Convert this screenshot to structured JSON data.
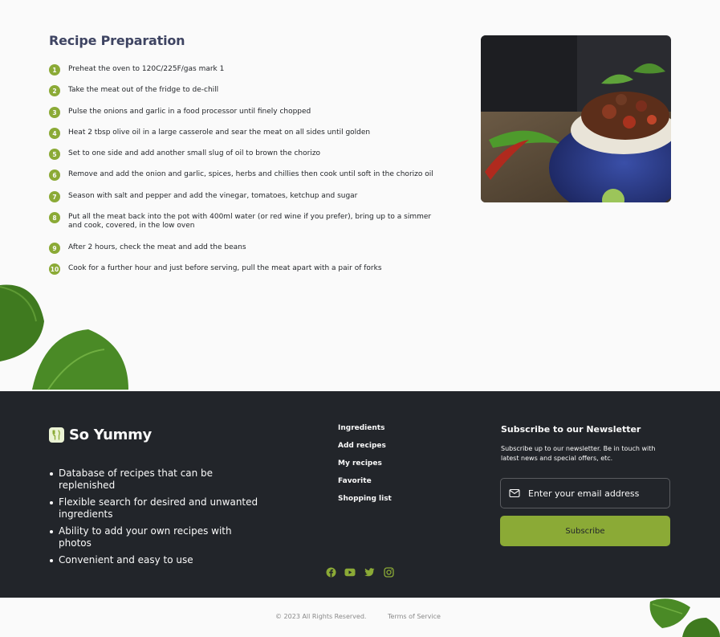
{
  "recipe": {
    "title": "Recipe Preparation",
    "steps": [
      {
        "num": "1",
        "text": "Preheat the oven to 120C/225F/gas mark 1"
      },
      {
        "num": "2",
        "text": "Take the meat out of the fridge to de-chill"
      },
      {
        "num": "3",
        "text": "Pulse the onions and garlic in a food processor until finely chopped"
      },
      {
        "num": "4",
        "text": "Heat 2 tbsp olive oil in a large casserole and sear the meat on all sides until golden"
      },
      {
        "num": "5",
        "text": "Set to one side and add another small slug of oil to brown the chorizo"
      },
      {
        "num": "6",
        "text": "Remove and add the onion and garlic, spices, herbs and chillies then cook until soft in the chorizo oil"
      },
      {
        "num": "7",
        "text": "Season with salt and pepper and add the vinegar, tomatoes, ketchup and sugar"
      },
      {
        "num": "8",
        "text": "Put all the meat back into the pot with 400ml water (or red wine if you prefer), bring up to a simmer and cook, covered, in the low oven"
      },
      {
        "num": "9",
        "text": "After 2 hours, check the meat and add the beans"
      },
      {
        "num": "10",
        "text": "Cook for a further hour and just before serving, pull the meat apart with a pair of forks"
      }
    ]
  },
  "footer": {
    "brand": "So Yummy",
    "benefits": [
      "Database of recipes that can be replenished",
      "Flexible search for desired and unwanted ingredients",
      "Ability to add your own recipes with photos",
      "Convenient and easy to use"
    ],
    "nav": [
      "Ingredients",
      "Add recipes",
      "My recipes",
      "Favorite",
      "Shopping list"
    ],
    "newsletter": {
      "title": "Subscribe to our Newsletter",
      "text": "Subscribe up to our newsletter. Be in touch with latest news and special offers, etc.",
      "placeholder": "Enter your email address",
      "button": "Subscribe"
    },
    "socials": [
      "facebook-icon",
      "youtube-icon",
      "twitter-icon",
      "instagram-icon"
    ]
  },
  "bottom": {
    "copyright": "© 2023 All Rights Reserved.",
    "terms": "Terms of Service"
  },
  "colors": {
    "accent": "#8BAA36",
    "dark": "#22252A",
    "title": "#3E4462",
    "background": "#FAFAFA"
  }
}
